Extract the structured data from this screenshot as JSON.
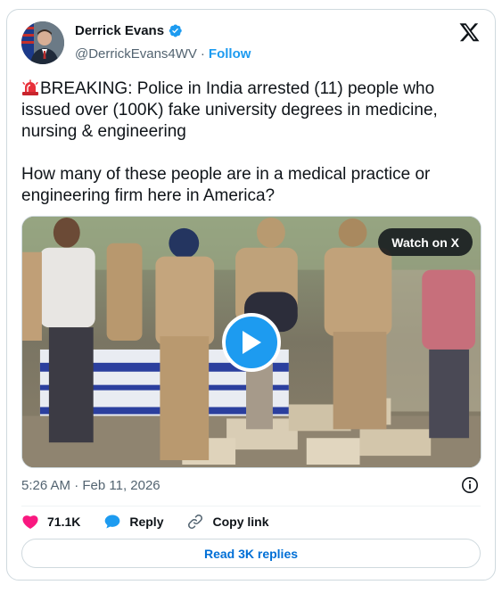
{
  "author": {
    "name": "Derrick Evans",
    "handle": "@DerrickEvans4WV",
    "separator": "·",
    "follow_label": "Follow"
  },
  "tweet": {
    "line1": "BREAKING: Police in India arrested (11) people who issued over (100K) fake university degrees in medicine, nursing & engineering",
    "line2": "How many of these people are in a medical practice or engineering firm here in America?"
  },
  "media": {
    "watch_label": "Watch on X"
  },
  "timestamp": "5:26 AM · Feb 11, 2026",
  "actions": {
    "likes": "71.1K",
    "reply_label": "Reply",
    "copy_label": "Copy link"
  },
  "read_replies_label": "Read 3K replies",
  "colors": {
    "accent": "#1d9bf0",
    "like": "#f91880",
    "text": "#0f1419",
    "muted": "#536471"
  }
}
